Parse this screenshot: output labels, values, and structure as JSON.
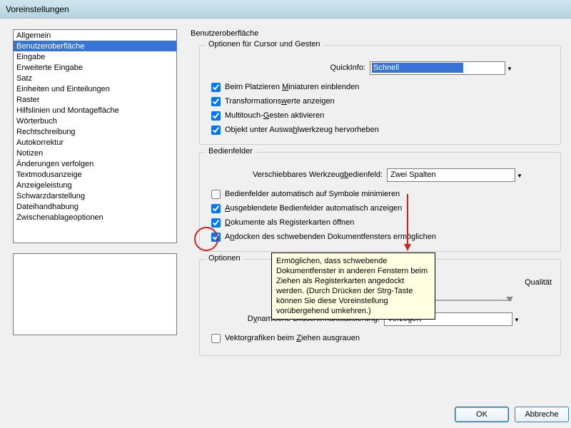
{
  "window_title": "Voreinstellungen",
  "categories": [
    "Allgemein",
    "Benutzeroberfläche",
    "Eingabe",
    "Erweiterte Eingabe",
    "Satz",
    "Einheiten und Einteilungen",
    "Raster",
    "Hilfslinien und Montagefläche",
    "Wörterbuch",
    "Rechtschreibung",
    "Autokorrektur",
    "Notizen",
    "Änderungen verfolgen",
    "Textmodusanzeige",
    "Anzeigeleistung",
    "Schwarzdarstellung",
    "Dateihandhabung",
    "Zwischenablageoptionen"
  ],
  "selected_category_index": 1,
  "panel_title": "Benutzeroberfläche",
  "group_cursor": {
    "label": "Optionen für Cursor und Gesten",
    "quickinfo_label": "QuickInfo:",
    "quickinfo_value": "Schnell",
    "cb1_a": "Beim Platzieren ",
    "cb1_u": "M",
    "cb1_b": "iniaturen einblenden",
    "cb2_a": "Transformations",
    "cb2_u": "w",
    "cb2_b": "erte anzeigen",
    "cb3_a": "Multitouch-",
    "cb3_u": "G",
    "cb3_b": "esten aktivieren",
    "cb4_a": "Objekt unter Auswa",
    "cb4_u": "h",
    "cb4_b": "lwerkzeug hervorheben"
  },
  "group_panels": {
    "label": "Bedienfelder",
    "toolpanel_label_a": "Verschiebbares Werkzeug",
    "toolpanel_label_u": "b",
    "toolpanel_label_b": "edienfeld:",
    "toolpanel_value": "Zwei Spalten",
    "cb5": "Bedienfelder automatisch auf Symbole minimieren",
    "cb6_u": "A",
    "cb6_b": "usgeblendete Bedienfelder automatisch anzeigen",
    "cb7_u": "D",
    "cb7_b": "okumente als Registerkarten öffnen",
    "cb8_a": "A",
    "cb8_u": "n",
    "cb8_b": "docken des schwebenden Dokumentfensters ermöglichen"
  },
  "tooltip_text": "Ermöglichen, dass schwebende Dokumentfenster in anderen Fenstern beim Ziehen als Registerkarten angedockt werden. (Durch Drücken der Strg-Taste können Sie diese Voreinstellung vorübergehend umkehren.)",
  "group_options": {
    "label": "Optionen",
    "quality_label": "Qualität",
    "screen_update_label_a": "D",
    "screen_update_label_u": "y",
    "screen_update_label_b": "namische Bildschirmaktualisierung:",
    "screen_update_value": "Verzögert",
    "cb9_a": "Vektorgrafiken beim ",
    "cb9_u": "Z",
    "cb9_b": "iehen ausgrauen"
  },
  "buttons": {
    "ok": "OK",
    "cancel": "Abbreche"
  }
}
